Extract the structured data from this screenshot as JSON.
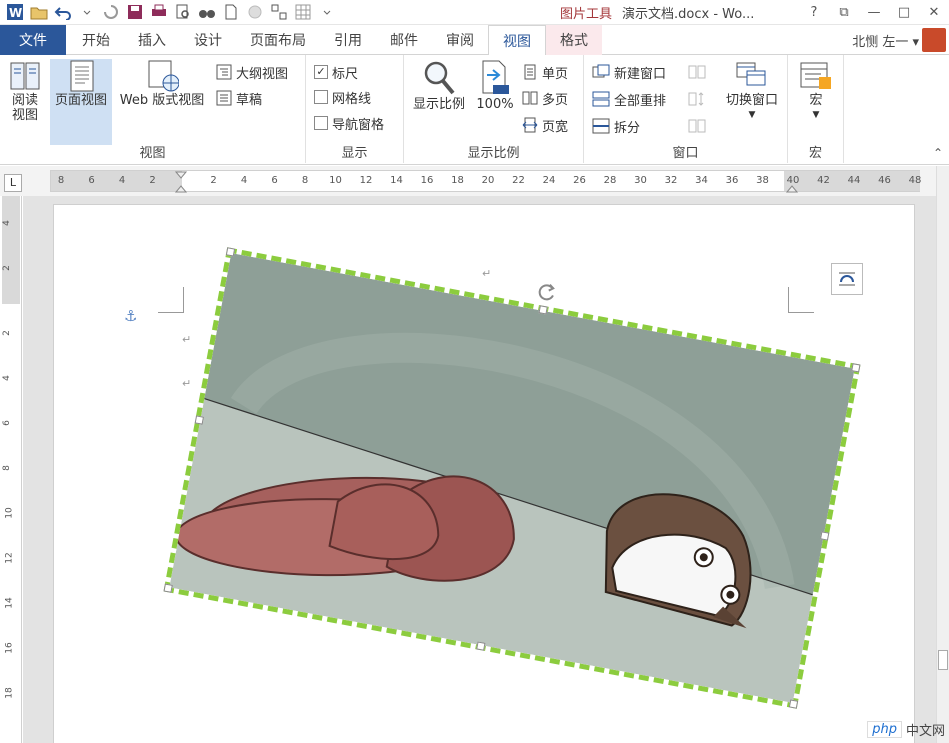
{
  "window": {
    "picture_tools": "图片工具",
    "doc_title": "演示文档.docx - Wo...",
    "help": "?",
    "restore": "⧉",
    "minimize": "—",
    "maximize": "□",
    "close": "✕"
  },
  "tabs": {
    "file": "文件",
    "items": [
      "开始",
      "插入",
      "设计",
      "页面布局",
      "引用",
      "邮件",
      "审阅",
      "视图",
      "格式"
    ],
    "active": "视图",
    "user": "北恻 左一 ▾"
  },
  "ribbon": {
    "views": {
      "label": "视图",
      "read_mode": "阅读\n视图",
      "print_layout": "页面视图",
      "web_layout": "Web 版式视图",
      "outline": "大纲视图",
      "draft": "草稿"
    },
    "show": {
      "label": "显示",
      "ruler": "标尺",
      "gridlines": "网格线",
      "nav_pane": "导航窗格",
      "ruler_checked": true
    },
    "zoom": {
      "label": "显示比例",
      "zoom": "显示比例",
      "hundred": "100%",
      "one_page": "单页",
      "multi_page": "多页",
      "page_width": "页宽"
    },
    "window": {
      "label": "窗口",
      "new_window": "新建窗口",
      "arrange_all": "全部重排",
      "split": "拆分",
      "switch_window": "切换窗口"
    },
    "macros": {
      "label": "宏",
      "macros": "宏"
    }
  },
  "ruler": {
    "tab_selector": "L",
    "h_ticks": [
      "8",
      "6",
      "4",
      "2",
      "2",
      "4",
      "6",
      "8",
      "10",
      "12",
      "14",
      "16",
      "18",
      "20",
      "22",
      "24",
      "26",
      "28",
      "30",
      "32",
      "34",
      "36",
      "38",
      "40",
      "42",
      "44",
      "46",
      "48"
    ],
    "v_ticks": [
      "4",
      "2",
      "2",
      "4",
      "6",
      "8",
      "10",
      "12",
      "14",
      "16",
      "18"
    ]
  },
  "watermark": {
    "logo": "php",
    "text": "中文网"
  },
  "colors": {
    "accent": "#2b579a",
    "selection_border": "#8ccc3e",
    "format_tab_bg": "#fbe9ec",
    "wall": "#8e9f97",
    "floor": "#b9c4bd",
    "slipper": "#a6605d"
  }
}
